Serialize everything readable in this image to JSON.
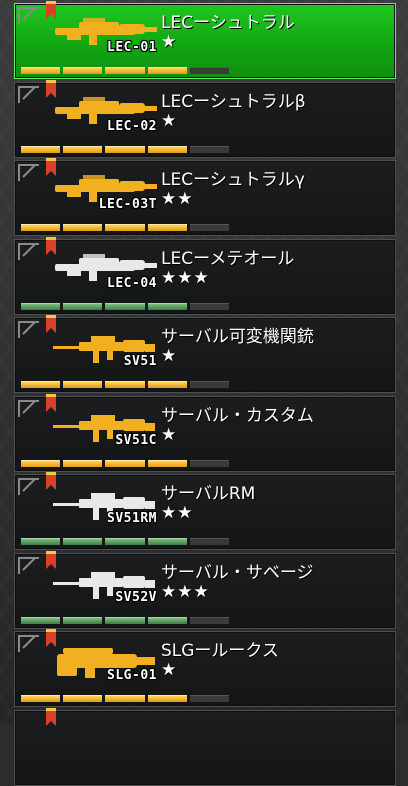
{
  "weapons": [
    {
      "name": "LECーシュトラル",
      "code": "LEC-01",
      "stars": "★",
      "gun_color": "gold",
      "bar_color": "gold",
      "selected": true
    },
    {
      "name": "LECーシュトラルβ",
      "code": "LEC-02",
      "stars": "★",
      "gun_color": "gold",
      "bar_color": "gold",
      "selected": false
    },
    {
      "name": "LECーシュトラルγ",
      "code": "LEC-03T",
      "stars": "★★",
      "gun_color": "gold",
      "bar_color": "gold",
      "selected": false
    },
    {
      "name": "LECーメテオール",
      "code": "LEC-04",
      "stars": "★★★",
      "gun_color": "white",
      "bar_color": "green",
      "selected": false
    },
    {
      "name": "サーバル可変機関銃",
      "code": "SV51",
      "stars": "★",
      "gun_color": "gold",
      "bar_color": "gold",
      "selected": false
    },
    {
      "name": "サーバル・カスタム",
      "code": "SV51C",
      "stars": "★",
      "gun_color": "gold",
      "bar_color": "gold",
      "selected": false
    },
    {
      "name": "サーバルRM",
      "code": "SV51RM",
      "stars": "★★",
      "gun_color": "white",
      "bar_color": "green",
      "selected": false
    },
    {
      "name": "サーバル・サベージ",
      "code": "SV52V",
      "stars": "★★★",
      "gun_color": "white",
      "bar_color": "green",
      "selected": false
    },
    {
      "name": "SLGールークス",
      "code": "SLG-01",
      "stars": "★",
      "gun_color": "gold",
      "bar_color": "gold",
      "selected": false
    }
  ],
  "colors": {
    "gold": "#f2b021",
    "white": "#e8e8e8",
    "green_selected": "#1fc71f",
    "ribbon": "#d9402a"
  },
  "icons": {
    "ribbon": "bookmark-ribbon-icon",
    "gun": "weapon-icon"
  }
}
